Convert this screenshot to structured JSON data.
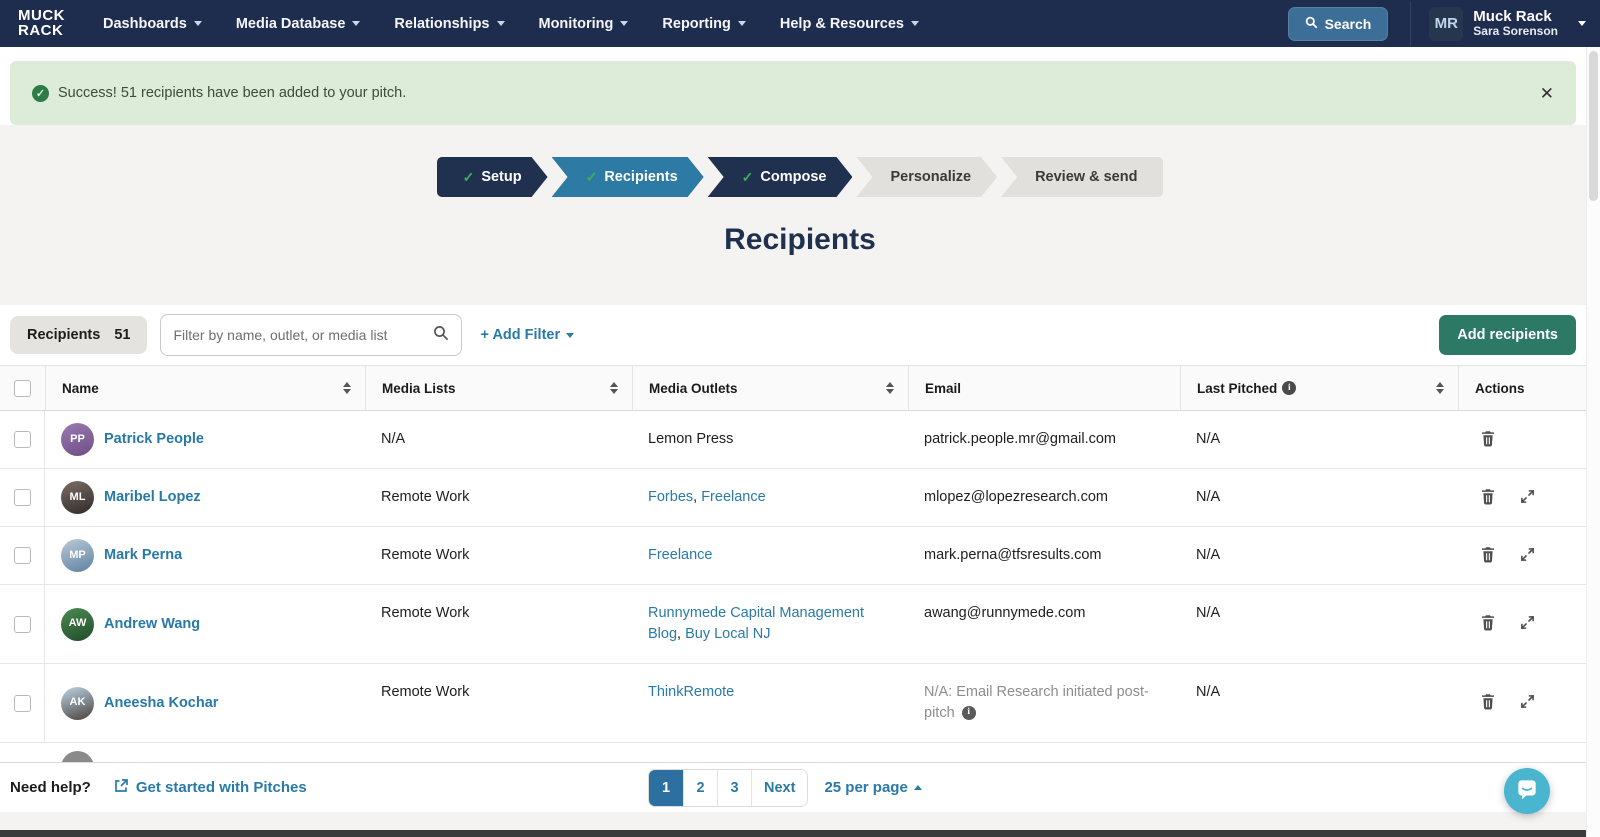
{
  "nav": {
    "logo_line1": "MUCK",
    "logo_line2": "RACK",
    "items": [
      {
        "label": "Dashboards"
      },
      {
        "label": "Media Database"
      },
      {
        "label": "Relationships"
      },
      {
        "label": "Monitoring"
      },
      {
        "label": "Reporting"
      },
      {
        "label": "Help & Resources"
      }
    ],
    "search_label": "Search",
    "account": {
      "initials": "MR",
      "org": "Muck Rack",
      "user": "Sara Sorenson"
    }
  },
  "banner": {
    "message": "Success! 51 recipients have been added to your pitch.",
    "close_glyph": "✕"
  },
  "steps": [
    {
      "label": "Setup",
      "state": "done"
    },
    {
      "label": "Recipients",
      "state": "current"
    },
    {
      "label": "Compose",
      "state": "done"
    },
    {
      "label": "Personalize",
      "state": "upcoming"
    },
    {
      "label": "Review & send",
      "state": "upcoming"
    }
  ],
  "page_title": "Recipients",
  "toolbar": {
    "tab_label": "Recipients",
    "tab_count": "51",
    "filter_placeholder": "Filter by name, outlet, or media list",
    "add_filter_label": "+ Add Filter",
    "add_recipients_label": "Add recipients"
  },
  "table": {
    "columns": [
      {
        "label": "Name",
        "sortable": true
      },
      {
        "label": "Media Lists",
        "sortable": true
      },
      {
        "label": "Media Outlets",
        "sortable": true
      },
      {
        "label": "Email",
        "sortable": false
      },
      {
        "label": "Last Pitched",
        "sortable": true,
        "info": true
      },
      {
        "label": "Actions",
        "sortable": false
      }
    ],
    "rows": [
      {
        "name": "Patrick People",
        "initials": "PP",
        "avatar_colors": [
          "#9a7ab0",
          "#6d4f86"
        ],
        "media_lists": "N/A",
        "outlets": [
          {
            "text": "Lemon Press",
            "link": false
          }
        ],
        "email": "patrick.people.mr@gmail.com",
        "email_muted": false,
        "email_info": false,
        "last_pitched": "N/A",
        "actions": {
          "trash": true,
          "expand": false
        }
      },
      {
        "name": "Maribel Lopez",
        "initials": "ML",
        "avatar_colors": [
          "#7d6e66",
          "#2f2a28"
        ],
        "media_lists": "Remote Work",
        "outlets": [
          {
            "text": "Forbes",
            "link": true
          },
          {
            "text": "Freelance",
            "link": true
          }
        ],
        "email": "mlopez@lopezresearch.com",
        "email_muted": false,
        "email_info": false,
        "last_pitched": "N/A",
        "actions": {
          "trash": true,
          "expand": true
        }
      },
      {
        "name": "Mark Perna",
        "initials": "MP",
        "avatar_colors": [
          "#b9c9d6",
          "#5f82a3"
        ],
        "media_lists": "Remote Work",
        "outlets": [
          {
            "text": "Freelance",
            "link": true
          }
        ],
        "email": "mark.perna@tfsresults.com",
        "email_muted": false,
        "email_info": false,
        "last_pitched": "N/A",
        "actions": {
          "trash": true,
          "expand": true
        }
      },
      {
        "name": "Andrew Wang",
        "initials": "AW",
        "avatar_colors": [
          "#4c8a50",
          "#1f4d2a"
        ],
        "media_lists": "Remote Work",
        "outlets": [
          {
            "text": "Runnymede Capital Management Blog",
            "link": true
          },
          {
            "text": "Buy Local NJ",
            "link": true
          }
        ],
        "email": "awang@runnymede.com",
        "email_muted": false,
        "email_info": false,
        "last_pitched": "N/A",
        "actions": {
          "trash": true,
          "expand": true
        }
      },
      {
        "name": "Aneesha Kochar",
        "initials": "AK",
        "avatar_colors": [
          "#bcd6e6",
          "#4a3f3a"
        ],
        "media_lists": "Remote Work",
        "outlets": [
          {
            "text": "ThinkRemote",
            "link": true
          }
        ],
        "email": "N/A: Email Research initiated post-pitch",
        "email_muted": true,
        "email_info": true,
        "last_pitched": "N/A",
        "actions": {
          "trash": true,
          "expand": true
        }
      }
    ]
  },
  "footer": {
    "need_help_label": "Need help?",
    "get_started_label": "Get started with Pitches",
    "pages": [
      {
        "label": "1",
        "active": true
      },
      {
        "label": "2",
        "active": false
      },
      {
        "label": "3",
        "active": false
      },
      {
        "label": "Next",
        "active": false
      }
    ],
    "per_page_label": "25 per page"
  },
  "icons": {
    "check": "✓",
    "close": "✕",
    "info": "i",
    "search": "magnifier",
    "caret_down": "triangle-down",
    "caret_up": "triangle-up",
    "sort": "up-down-arrows",
    "trash": "trash-can",
    "expand": "diagonal-resize-arrows",
    "external_link": "box-with-arrow",
    "chat": "speech-bubble"
  },
  "colors": {
    "nav_bg": "#1e2c4e",
    "step_done": "#20304f",
    "step_current": "#2d7aa4",
    "step_upcoming": "#e2e0dc",
    "success_bg": "#dcecd8",
    "success_icon": "#2c7c47",
    "link_blue": "#2a7aa8",
    "button_green": "#2c7a66",
    "pagination_active": "#2d6f9e",
    "chat_teal": "#4ab5cf"
  }
}
